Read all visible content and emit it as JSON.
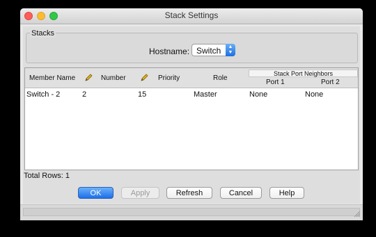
{
  "window": {
    "title": "Stack Settings"
  },
  "stacks": {
    "group_title": "Stacks",
    "hostname_label": "Hostname:",
    "hostname_value": "Switch"
  },
  "table": {
    "group_header": "Stack Port Neighbors",
    "columns": [
      "Member Name",
      "Number",
      "Priority",
      "Role",
      "Port 1",
      "Port 2"
    ],
    "rows": [
      {
        "member_name": "Switch - 2",
        "number": "2",
        "priority": "15",
        "role": "Master",
        "port1": "None",
        "port2": "None"
      }
    ]
  },
  "footer": {
    "total_rows": "Total Rows: 1"
  },
  "buttons": {
    "ok": "OK",
    "apply": "Apply",
    "refresh": "Refresh",
    "cancel": "Cancel",
    "help": "Help"
  },
  "colors": {
    "primary_button": "#1d6fe8",
    "close": "#fc5f57",
    "minimize": "#fdbc2e",
    "maximize": "#33c748"
  },
  "icons": {
    "edit_column": "pencil-icon",
    "hostname_dropdown": "updown-arrow-icon",
    "resize": "resize-grip-icon"
  }
}
